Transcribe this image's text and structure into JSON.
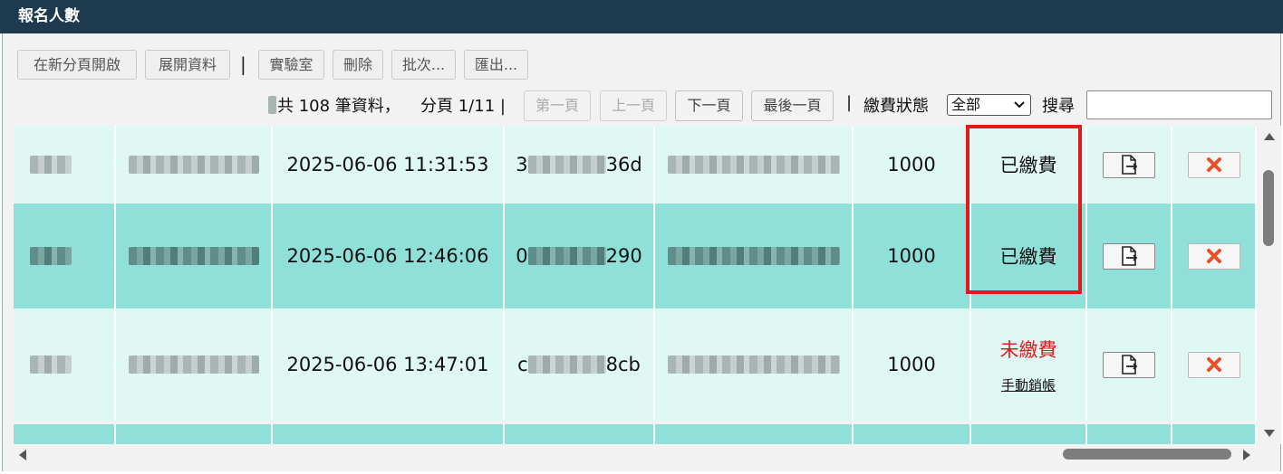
{
  "window": {
    "title": "報名人數"
  },
  "toolbar": {
    "buttons": [
      "在新分頁開啟",
      "展開資料",
      "實驗室",
      "刪除",
      "批次...",
      "匯出..."
    ],
    "separator": "|"
  },
  "pager": {
    "total_text": "共 108 筆資料，",
    "page_text": "分頁 1/11 |",
    "first": "第一頁",
    "prev": "上一頁",
    "next": "下一頁",
    "last": "最後一頁",
    "separator": "|",
    "status_label": "繳費狀態",
    "status_value": "全部",
    "search_label": "搜尋",
    "search_value": ""
  },
  "rows": [
    {
      "time": "2025-06-06 11:31:53",
      "code_prefix": "3",
      "code_suffix": "36d",
      "amount": "1000",
      "status": "已繳費",
      "status_kind": "paid",
      "action": ""
    },
    {
      "time": "2025-06-06 12:46:06",
      "code_prefix": "0",
      "code_suffix": "290",
      "amount": "1000",
      "status": "已繳費",
      "status_kind": "paid",
      "action": ""
    },
    {
      "time": "2025-06-06 13:47:01",
      "code_prefix": "c",
      "code_suffix": "8cb",
      "amount": "1000",
      "status": "未繳費",
      "status_kind": "unpaid",
      "action": "手動銷帳"
    }
  ],
  "icons": {
    "open": "document-arrow-icon",
    "delete": "red-x-icon",
    "scroll_up": "triangle-up-icon",
    "scroll_down": "triangle-down-icon",
    "scroll_left": "triangle-left-icon",
    "scroll_right": "triangle-right-icon"
  },
  "colors": {
    "titlebar": "#1e3a4f",
    "row_light": "#e0f8f4",
    "row_dark": "#8ee0d8",
    "unpaid": "#d42020",
    "highlight": "#e51919"
  }
}
